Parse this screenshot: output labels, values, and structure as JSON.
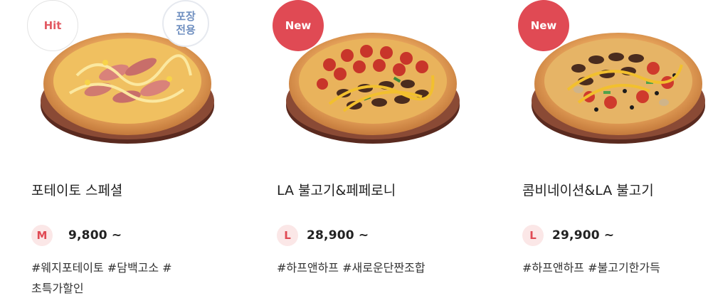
{
  "products": [
    {
      "badge": "Hit",
      "pack_badge": "포장\n전용",
      "name": "포테이토 스페셜",
      "size": "M",
      "price": "9,800 ~",
      "tags": "#웨지포테이토 #담백고소 # 초특가할인"
    },
    {
      "badge": "New",
      "name": "LA 불고기&페페로니",
      "size": "L",
      "price": "28,900 ~",
      "tags": "#하프앤하프 #새로운단짠조합"
    },
    {
      "badge": "New",
      "name": "콤비네이션&LA 불고기",
      "size": "L",
      "price": "29,900 ~",
      "tags": "#하프앤하프 #불고기한가득"
    }
  ],
  "colors": {
    "badge_new": "#e04a54",
    "badge_hit_text": "#e25a63",
    "pack_text": "#6f8fc0",
    "size_badge_bg": "#fbe7e7",
    "size_badge_text": "#e04a54"
  }
}
